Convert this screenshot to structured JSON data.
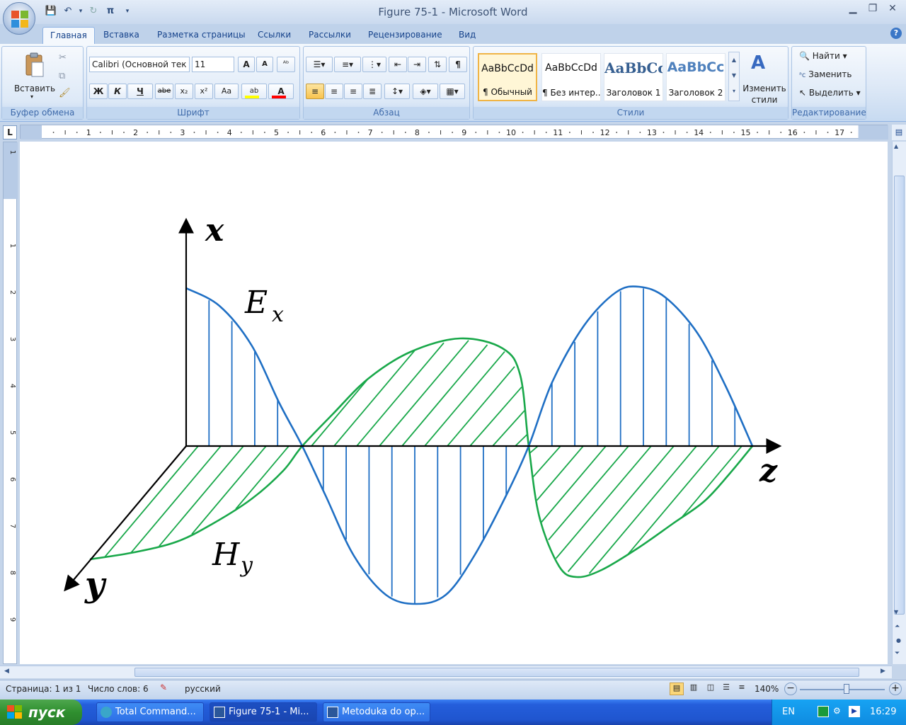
{
  "window": {
    "title": "Figure 75-1 - Microsoft Word"
  },
  "quick_access": [
    "save-icon",
    "undo-icon",
    "redo-icon",
    "pi-icon",
    "customize-icon"
  ],
  "quick_access_pi": "π",
  "tabs": [
    "Главная",
    "Вставка",
    "Разметка страницы",
    "Ссылки",
    "Рассылки",
    "Рецензирование",
    "Вид"
  ],
  "ribbon": {
    "clipboard": {
      "paste_label": "Вставить",
      "group_label": "Буфер обмена"
    },
    "font": {
      "font_name": "Calibri (Основной тек",
      "font_size": "11",
      "bold": "Ж",
      "italic": "К",
      "underline": "Ч",
      "strike": "abe",
      "sub": "x₂",
      "sup": "x²",
      "case": "Aa",
      "grow": "A",
      "shrink": "A",
      "group_label": "Шрифт",
      "highlight_color": "#ffff00",
      "font_color": "#ff0000"
    },
    "paragraph": {
      "group_label": "Абзац",
      "show_marks": "¶"
    },
    "styles": {
      "group_label": "Стили",
      "items": [
        {
          "sample": "AaBbCcDd",
          "name": "¶ Обычный"
        },
        {
          "sample": "AaBbCcDd",
          "name": "¶ Без интер..."
        },
        {
          "sample": "AaBbCc",
          "name": "Заголовок 1"
        },
        {
          "sample": "AaBbCc",
          "name": "Заголовок 2"
        }
      ],
      "change_styles_1": "Изменить",
      "change_styles_2": "стили"
    },
    "editing": {
      "group_label": "Редактирование",
      "find": "Найти",
      "replace": "Заменить",
      "select": "Выделить"
    }
  },
  "ruler": {
    "h_numbers": [
      "1",
      "2",
      "3",
      "4",
      "5",
      "6",
      "7",
      "8",
      "9",
      "10",
      "11",
      "12",
      "13",
      "14",
      "15",
      "16",
      "17"
    ],
    "v_numbers": [
      "1",
      "1",
      "2",
      "3",
      "4",
      "5",
      "6",
      "7",
      "8",
      "9"
    ]
  },
  "figure": {
    "x_label": "x",
    "z_label": "z",
    "y_label": "y",
    "e_label": "E",
    "e_sub": "x",
    "h_label": "H",
    "h_sub": "y",
    "e_color": "#1f6fc4",
    "h_color": "#19a84a"
  },
  "status": {
    "page": "Страница: 1 из 1",
    "words": "Число слов: 6",
    "language": "русский",
    "zoom": "140%"
  },
  "taskbar": {
    "start": "пуск",
    "tasks": [
      "Total Command...",
      "Figure 75-1 - Mi...",
      "Metoduka do op..."
    ],
    "lang": "EN",
    "clock": "16:29"
  }
}
